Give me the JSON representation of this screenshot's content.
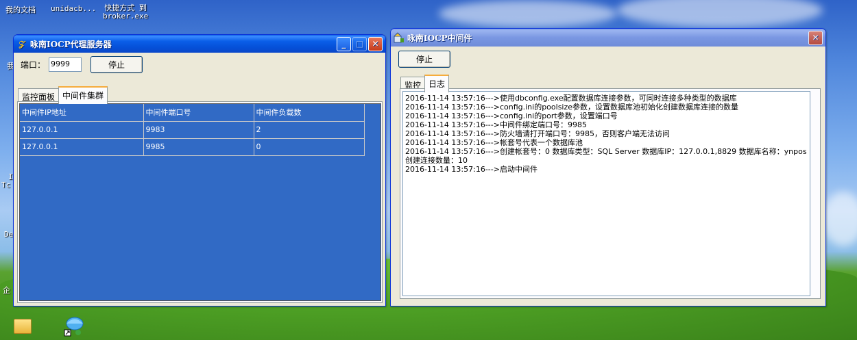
{
  "desktop": {
    "icons": [
      {
        "label": "我的文档"
      },
      {
        "label": "unidacb..."
      },
      {
        "label": "快捷方式 到\nbroker.exe"
      }
    ],
    "edge_labels": [
      "我",
      "I",
      "Tc",
      "De",
      "企"
    ]
  },
  "proxy_window": {
    "title": "咏南IOCP代理服务器",
    "port_label": "端口：",
    "port_value": "9999",
    "stop_button": "停止",
    "tabs": [
      {
        "label": "监控面板"
      },
      {
        "label": "中间件集群"
      }
    ],
    "columns": [
      "中间件IP地址",
      "中间件端口号",
      "中间件负载数"
    ],
    "rows": [
      [
        "127.0.0.1",
        "9983",
        "2"
      ],
      [
        "127.0.0.1",
        "9985",
        "0"
      ]
    ]
  },
  "middleware_window": {
    "title": "咏南IOCP中间件",
    "stop_button": "停止",
    "tabs": [
      {
        "label": "监控"
      },
      {
        "label": "日志"
      }
    ],
    "log_lines": [
      "2016-11-14 13:57:16--->使用dbconfig.exe配置数据库连接参数，可同时连接多种类型的数据库",
      "2016-11-14 13:57:16--->config.ini的poolsize参数，设置数据库池初始化创建数据库连接的数量",
      "2016-11-14 13:57:16--->config.ini的port参数，设置端口号",
      "2016-11-14 13:57:16--->中间件绑定端口号：9985",
      "2016-11-14 13:57:16--->防火墙请打开端口号：9985，否则客户端无法访问",
      "2016-11-14 13:57:16--->帐套号代表一个数据库池",
      "2016-11-14 13:57:16--->创建帐套号：0 数据库类型：SQL Server 数据库IP：127.0.0.1,8829 数据库名称：ynpos",
      "创建连接数量：10",
      "2016-11-14 13:57:16--->启动中间件"
    ]
  }
}
